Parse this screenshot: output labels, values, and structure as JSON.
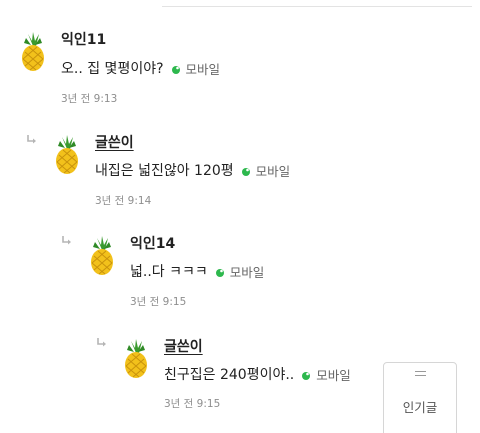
{
  "comments": [
    {
      "name": "익인11",
      "text": "오.. 집 몇평이야?",
      "device": "모바일",
      "time": "3년 전 9:13",
      "is_author": false
    },
    {
      "name": "글쓴이",
      "text": "내집은 넓진않아 120평",
      "device": "모바일",
      "time": "3년 전 9:14",
      "is_author": true
    },
    {
      "name": "익인14",
      "text": "넓..다 ㅋㅋㅋ",
      "device": "모바일",
      "time": "3년 전 9:15",
      "is_author": false
    },
    {
      "name": "글쓴이",
      "text": "친구집은 240평이야..",
      "device": "모바일",
      "time": "3년 전 9:15",
      "is_author": true
    }
  ],
  "floating_button": {
    "icon": "menu-icon",
    "label": "인기글"
  },
  "colors": {
    "mobile_dot": "#2db84d",
    "pineapple_body": "#f2c11b",
    "pineapple_leaf": "#3a9a2e"
  }
}
